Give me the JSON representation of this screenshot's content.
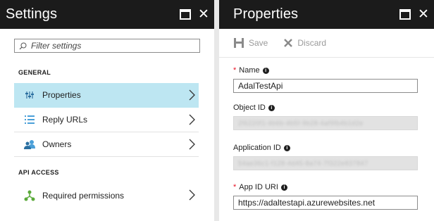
{
  "settings": {
    "title": "Settings",
    "filter_placeholder": "Filter settings",
    "sections": [
      {
        "label": "GENERAL",
        "items": [
          {
            "label": "Properties",
            "icon": "properties-icon",
            "active": true
          },
          {
            "label": "Reply URLs",
            "icon": "list-icon",
            "active": false
          },
          {
            "label": "Owners",
            "icon": "users-icon",
            "active": false
          }
        ]
      },
      {
        "label": "API ACCESS",
        "items": [
          {
            "label": "Required permissions",
            "icon": "permissions-icon",
            "active": false
          }
        ]
      }
    ]
  },
  "properties": {
    "title": "Properties",
    "save_label": "Save",
    "discard_label": "Discard",
    "fields": {
      "name": {
        "label": "Name",
        "value": "AdalTestApi",
        "required": true
      },
      "object_id": {
        "label": "Object ID",
        "value": "2f6220f1-4b6b-4b5f-9b28-4af9fb4b1d2e",
        "required": false
      },
      "application_id": {
        "label": "Application ID",
        "value": "54ae36c1-f128-4d45-8a74-7f322e837847",
        "required": false
      },
      "app_id_uri": {
        "label": "App ID URI",
        "value": "https://adaltestapi.azurewebsites.net",
        "required": true
      }
    }
  },
  "colors": {
    "header_bg": "#1b1b1b",
    "active_item_bg": "#bde6f2",
    "required_star": "#e81123",
    "icon_blue": "#4a9fd8",
    "icon_green": "#5aaa3a"
  }
}
